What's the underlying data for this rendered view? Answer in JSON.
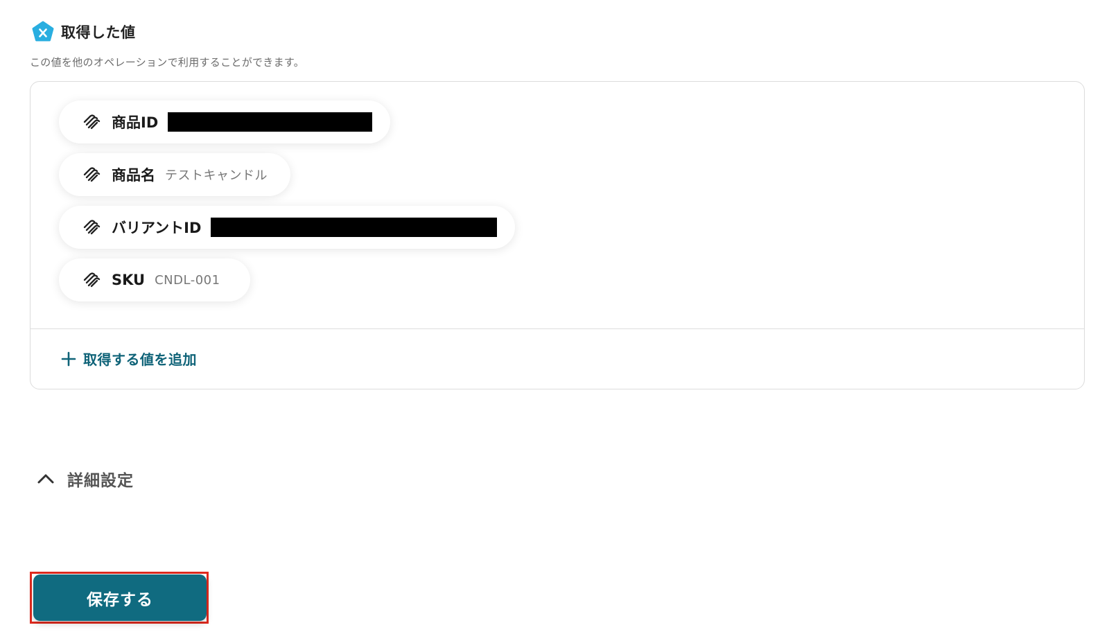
{
  "section": {
    "title": "取得した値",
    "description": "この値を他のオペレーションで利用することができます。",
    "icon": "variable-x-pentagon-icon",
    "icon_color": "#29aee0"
  },
  "values": [
    {
      "label": "商品ID",
      "value": "",
      "redacted": true,
      "icon": "squarespace-logo-icon"
    },
    {
      "label": "商品名",
      "value": "テストキャンドル",
      "redacted": false,
      "icon": "squarespace-logo-icon"
    },
    {
      "label": "バリアントID",
      "value": "",
      "redacted": true,
      "icon": "squarespace-logo-icon"
    },
    {
      "label": "SKU",
      "value": "CNDL-001",
      "redacted": false,
      "icon": "squarespace-logo-icon"
    }
  ],
  "add_value": {
    "label": "取得する値を追加",
    "icon": "plus-icon"
  },
  "advanced": {
    "label": "詳細設定",
    "icon": "chevron-up-icon",
    "expanded": true
  },
  "save": {
    "label": "保存する"
  },
  "colors": {
    "accent": "#106b80",
    "link": "#0f6378",
    "highlight_border": "#e02a1e",
    "redaction": "#000000"
  }
}
